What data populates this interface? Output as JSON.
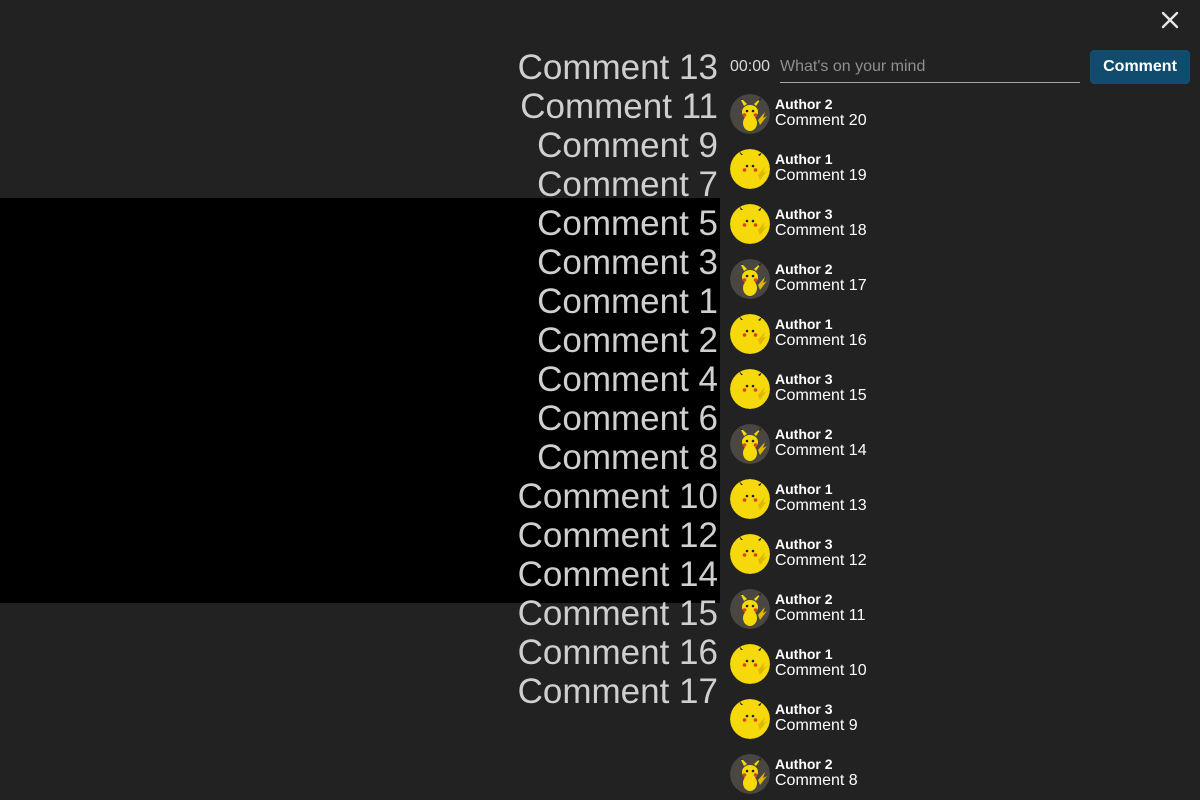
{
  "close_icon": "close-icon",
  "overlay": {
    "comments": [
      "Comment 13",
      "Comment 11",
      "Comment 9",
      "Comment 7",
      "Comment 5",
      "Comment 3",
      "Comment 1",
      "Comment 2",
      "Comment 4",
      "Comment 6",
      "Comment 8",
      "Comment 10",
      "Comment 12",
      "Comment 14",
      "Comment 15",
      "Comment 16",
      "Comment 17"
    ]
  },
  "composer": {
    "timestamp": "00:00",
    "placeholder": "What's on your mind",
    "value": "",
    "button_label": "Comment"
  },
  "comments": [
    {
      "author": "Author 2",
      "text": "Comment 20",
      "avatar": "pikachu-avatar-dark"
    },
    {
      "author": "Author 1",
      "text": "Comment 19",
      "avatar": "pikachu-avatar-yellow"
    },
    {
      "author": "Author 3",
      "text": "Comment 18",
      "avatar": "pikachu-avatar-yellow"
    },
    {
      "author": "Author 2",
      "text": "Comment 17",
      "avatar": "pikachu-avatar-dark"
    },
    {
      "author": "Author 1",
      "text": "Comment 16",
      "avatar": "pikachu-avatar-yellow"
    },
    {
      "author": "Author 3",
      "text": "Comment 15",
      "avatar": "pikachu-avatar-yellow"
    },
    {
      "author": "Author 2",
      "text": "Comment 14",
      "avatar": "pikachu-avatar-dark"
    },
    {
      "author": "Author 1",
      "text": "Comment 13",
      "avatar": "pikachu-avatar-yellow"
    },
    {
      "author": "Author 3",
      "text": "Comment 12",
      "avatar": "pikachu-avatar-yellow"
    },
    {
      "author": "Author 2",
      "text": "Comment 11",
      "avatar": "pikachu-avatar-dark"
    },
    {
      "author": "Author 1",
      "text": "Comment 10",
      "avatar": "pikachu-avatar-yellow"
    },
    {
      "author": "Author 3",
      "text": "Comment 9",
      "avatar": "pikachu-avatar-yellow"
    },
    {
      "author": "Author 2",
      "text": "Comment 8",
      "avatar": "pikachu-avatar-dark"
    }
  ],
  "colors": {
    "background": "#222222",
    "video": "#000000",
    "button": "#0f4c6e",
    "overlay_text": "#cfcfcf",
    "avatar_yellow": "#f5d90a",
    "avatar_dark": "#4a4642"
  }
}
